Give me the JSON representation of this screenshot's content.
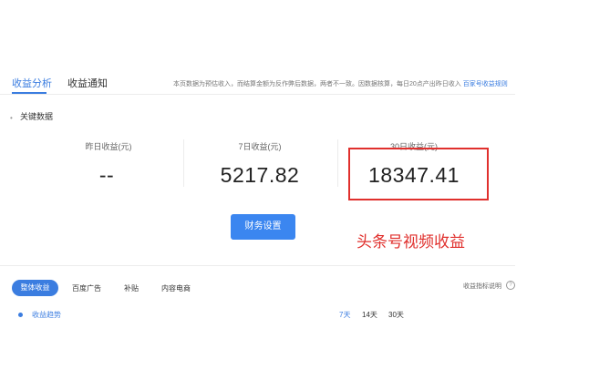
{
  "tabs": [
    {
      "label": "收益分析",
      "active": true
    },
    {
      "label": "收益通知",
      "active": false
    }
  ],
  "notice": {
    "text": "本页数据为预估收入，而结算金额为反作弊后数据，两者不一致。因数据核算，每日20点产出昨日收入",
    "link": "百家号收益规则"
  },
  "section": {
    "bullet": "•",
    "title": "关键数据"
  },
  "stats": [
    {
      "label": "昨日收益(元)",
      "value": "--"
    },
    {
      "label": "7日收益(元)",
      "value": "5217.82"
    },
    {
      "label": "30日收益(元)",
      "value": "18347.41"
    }
  ],
  "finance_button": "财务设置",
  "annotation": "头条号视频收益",
  "filter_tabs": [
    {
      "label": "整体收益",
      "active": true
    },
    {
      "label": "百度广告",
      "active": false
    },
    {
      "label": "补贴",
      "active": false
    },
    {
      "label": "内容电商",
      "active": false
    }
  ],
  "help": {
    "text": "收益指标说明",
    "icon": "?"
  },
  "trend": {
    "label": "收益趋势"
  },
  "ranges": [
    {
      "label": "7天",
      "active": true
    },
    {
      "label": "14天",
      "active": false
    },
    {
      "label": "30天",
      "active": false
    }
  ],
  "colors": {
    "accent": "#3b7de0",
    "highlight": "#e0302d"
  }
}
